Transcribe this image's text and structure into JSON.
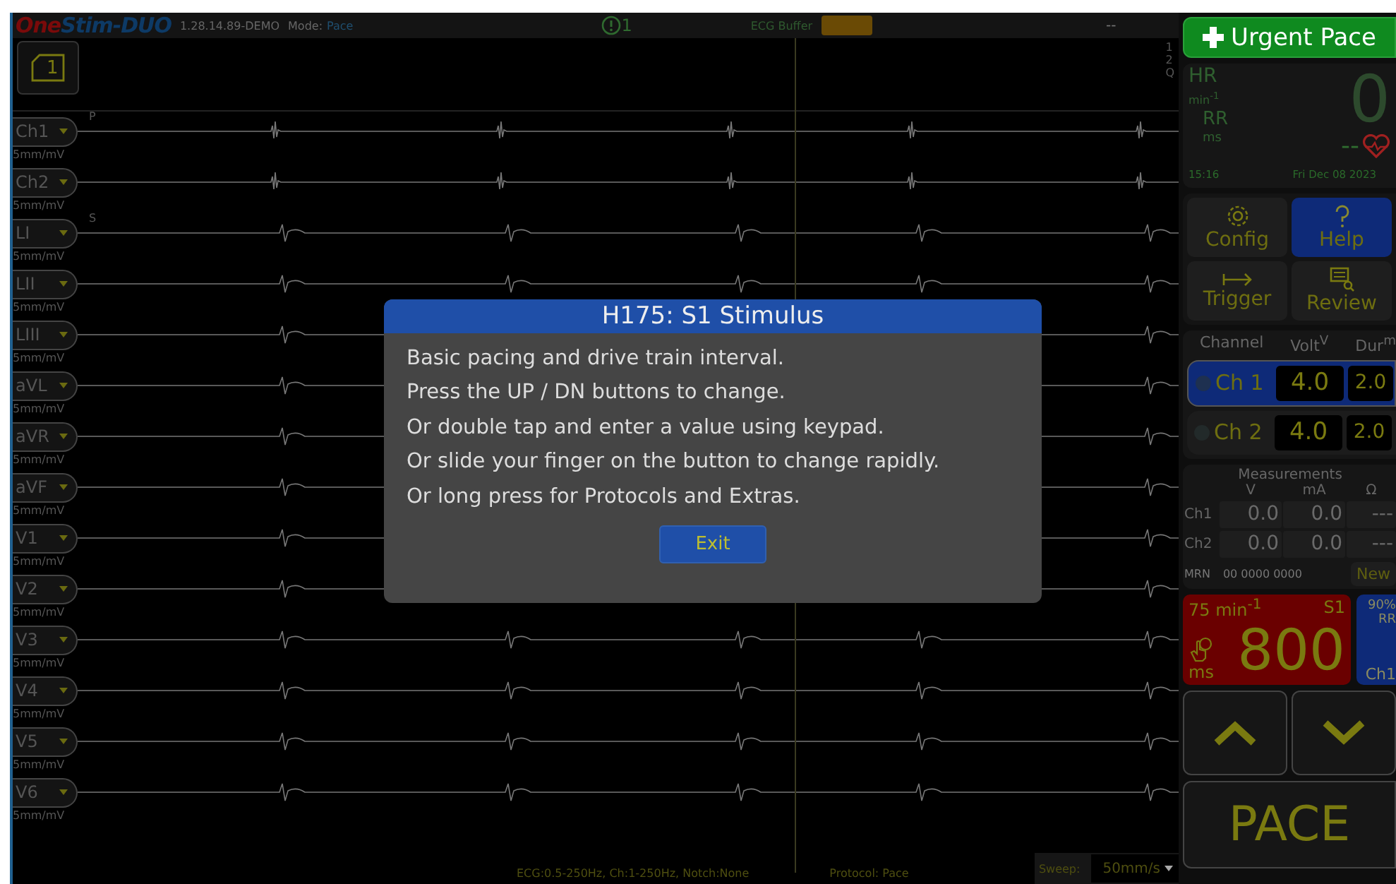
{
  "header": {
    "logo_part_1": "One",
    "logo_part_2": "Stim-DUO",
    "version": "1.28.14.89-DEMO",
    "mode_label": "Mode:",
    "mode": "Pace",
    "alert_count": "1",
    "buffer_label": "ECG Buffer",
    "status": "--"
  },
  "page_button": "1",
  "trace_scale": [
    "1",
    "2",
    "Q"
  ],
  "leads": [
    {
      "label": "Ch1",
      "scale": "5mm/mV",
      "marker": "P"
    },
    {
      "label": "Ch2",
      "scale": "5mm/mV"
    },
    {
      "label": "LI",
      "scale": "5mm/mV",
      "marker": "S"
    },
    {
      "label": "LII",
      "scale": "5mm/mV"
    },
    {
      "label": "LIII",
      "scale": "5mm/mV"
    },
    {
      "label": "aVL",
      "scale": "5mm/mV"
    },
    {
      "label": "aVR",
      "scale": "5mm/mV"
    },
    {
      "label": "aVF",
      "scale": "5mm/mV"
    },
    {
      "label": "V1",
      "scale": "5mm/mV"
    },
    {
      "label": "V2",
      "scale": "5mm/mV"
    },
    {
      "label": "V3",
      "scale": "5mm/mV"
    },
    {
      "label": "V4",
      "scale": "5mm/mV"
    },
    {
      "label": "V5",
      "scale": "5mm/mV"
    },
    {
      "label": "V6",
      "scale": "5mm/mV"
    }
  ],
  "dialog": {
    "title": "H175: S1 Stimulus",
    "lines": [
      "Basic pacing and drive train interval.",
      "Press the UP / DN buttons to change.",
      "Or double tap and enter a value using keypad.",
      "Or slide your finger on the button to change rapidly.",
      "Or long press for Protocols and Extras."
    ],
    "button": "Exit"
  },
  "urgent_button": "Urgent Pace",
  "vitals": {
    "hr_label": "HR",
    "hr_unit": "min$^{-1}$",
    "hr_value": "0",
    "rr_label": "RR",
    "rr_unit": "ms",
    "rr_value": "--",
    "time": "15:16",
    "date": "Fri Dec 08 2023"
  },
  "menu_buttons": [
    {
      "label": "Config",
      "highlighted": false
    },
    {
      "label": "Help",
      "highlighted": true
    },
    {
      "label": "Trigger",
      "highlighted": false
    },
    {
      "label": "Review",
      "highlighted": false
    }
  ],
  "channel_table": {
    "columns": [
      "Channel",
      "Volt$^{V}$",
      "Dur$^{m}$"
    ],
    "rows": [
      {
        "name": "Ch 1",
        "volt": "4.0",
        "dur": "2.0",
        "selected": true
      },
      {
        "name": "Ch 2",
        "volt": "4.0",
        "dur": "2.0",
        "selected": false
      }
    ]
  },
  "measurements": {
    "title": "Measurements",
    "columns": [
      "V",
      "mA",
      "Ω"
    ],
    "rows": [
      {
        "name": "Ch1",
        "values": [
          "0.0",
          "0.0",
          "---"
        ]
      },
      {
        "name": "Ch2",
        "values": [
          "0.0",
          "0.0",
          "---"
        ]
      }
    ],
    "mrn_label": "MRN",
    "mrn": "00 0000 0000",
    "new_button": "New"
  },
  "stimulus": {
    "rate": "75 min$^{-1}$",
    "name": "S1",
    "value": "800",
    "unit": "ms"
  },
  "ratio": {
    "percent": "90%",
    "label": "RR",
    "channel": "Ch1"
  },
  "pace_button": "PACE",
  "status_bar": {
    "filters": "ECG:0.5-250Hz, Ch:1-250Hz, Notch:None",
    "protocol": "Protocol: Pace",
    "sweep_label": "Sweep:",
    "sweep": "50mm/s"
  }
}
